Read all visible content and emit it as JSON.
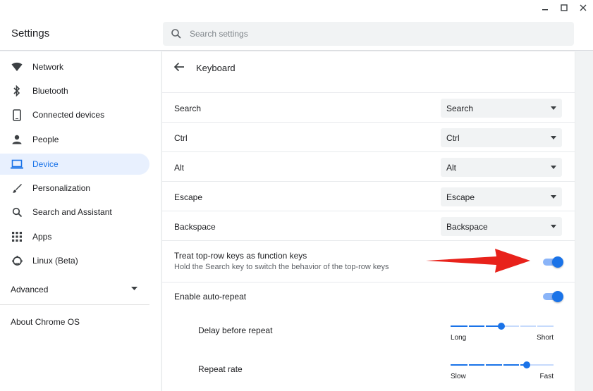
{
  "window": {
    "controls": [
      "minimize-icon",
      "maximize-icon",
      "close-icon"
    ]
  },
  "header": {
    "title": "Settings",
    "search_placeholder": "Search settings"
  },
  "sidebar": {
    "items": [
      {
        "label": "Network",
        "icon": "wifi-icon",
        "active": false
      },
      {
        "label": "Bluetooth",
        "icon": "bluetooth-icon",
        "active": false
      },
      {
        "label": "Connected devices",
        "icon": "phone-icon",
        "active": false
      },
      {
        "label": "People",
        "icon": "person-icon",
        "active": false
      },
      {
        "label": "Device",
        "icon": "laptop-icon",
        "active": true
      },
      {
        "label": "Personalization",
        "icon": "brush-icon",
        "active": false
      },
      {
        "label": "Search and Assistant",
        "icon": "search-icon",
        "active": false
      },
      {
        "label": "Apps",
        "icon": "apps-grid-icon",
        "active": false
      },
      {
        "label": "Linux (Beta)",
        "icon": "linux-icon",
        "active": false
      }
    ],
    "advanced": "Advanced",
    "about": "About Chrome OS"
  },
  "main": {
    "title": "Keyboard",
    "remaps": [
      {
        "label": "Search",
        "value": "Search"
      },
      {
        "label": "Ctrl",
        "value": "Ctrl"
      },
      {
        "label": "Alt",
        "value": "Alt"
      },
      {
        "label": "Escape",
        "value": "Escape"
      },
      {
        "label": "Backspace",
        "value": "Backspace"
      }
    ],
    "function_keys": {
      "label": "Treat top-row keys as function keys",
      "sublabel": "Hold the Search key to switch the behavior of the top-row keys",
      "enabled": true
    },
    "auto_repeat": {
      "label": "Enable auto-repeat",
      "enabled": true
    },
    "delay": {
      "label": "Delay before repeat",
      "min_label": "Long",
      "max_label": "Short",
      "value_fraction": 0.49
    },
    "rate": {
      "label": "Repeat rate",
      "min_label": "Slow",
      "max_label": "Fast",
      "value_fraction": 0.74
    }
  },
  "colors": {
    "accent": "#1a73e8",
    "active_bg": "#e8f0fe",
    "annotation_arrow": "#e8221b"
  }
}
